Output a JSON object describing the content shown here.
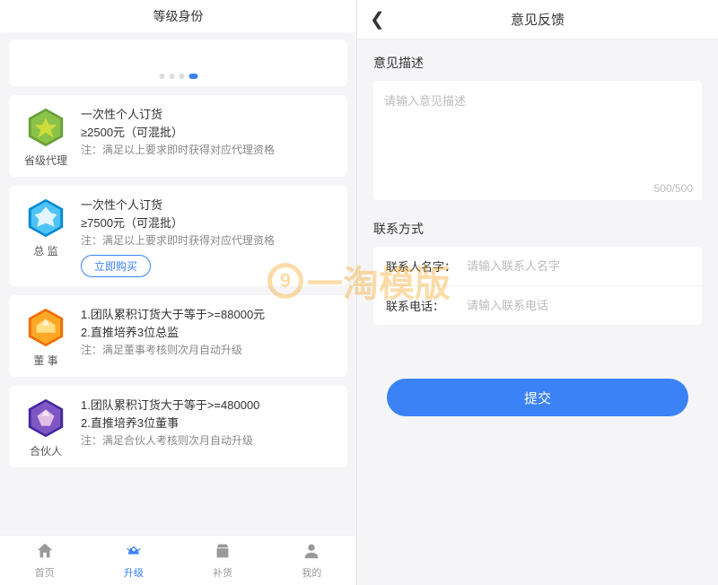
{
  "left": {
    "title": "等级身份",
    "levels": [
      {
        "label": "省级代理",
        "lines": [
          "一次性个人订货",
          "≥2500元（可混批）"
        ],
        "note": "注：满足以上要求即时获得对应代理资格",
        "buy": null,
        "color": "green"
      },
      {
        "label": "总 监",
        "lines": [
          "一次性个人订货",
          "≥7500元（可混批）"
        ],
        "note": "注：满足以上要求即时获得对应代理资格",
        "buy": "立即购买",
        "color": "blue"
      },
      {
        "label": "董 事",
        "lines": [
          "1.团队累积订货大于等于>=88000元",
          "2.直推培养3位总监"
        ],
        "note": "注：满足董事考核则次月自动升级",
        "buy": null,
        "color": "orange"
      },
      {
        "label": "合伙人",
        "lines": [
          "1.团队累积订货大于等于>=480000",
          "2.直推培养3位董事"
        ],
        "note": "注：满足合伙人考核则次月自动升级",
        "buy": null,
        "color": "purple"
      }
    ],
    "tabs": [
      {
        "label": "首页",
        "active": false
      },
      {
        "label": "升级",
        "active": true
      },
      {
        "label": "补货",
        "active": false
      },
      {
        "label": "我的",
        "active": false
      }
    ]
  },
  "right": {
    "title": "意见反馈",
    "desc_label": "意见描述",
    "desc_placeholder": "请输入意见描述",
    "counter": "500/500",
    "contact_label": "联系方式",
    "fields": [
      {
        "label": "联系人名字：",
        "placeholder": "请输入联系人名字"
      },
      {
        "label": "联系电话：",
        "placeholder": "请输入联系电话"
      }
    ],
    "submit": "提交"
  },
  "watermark": "一淘模版"
}
